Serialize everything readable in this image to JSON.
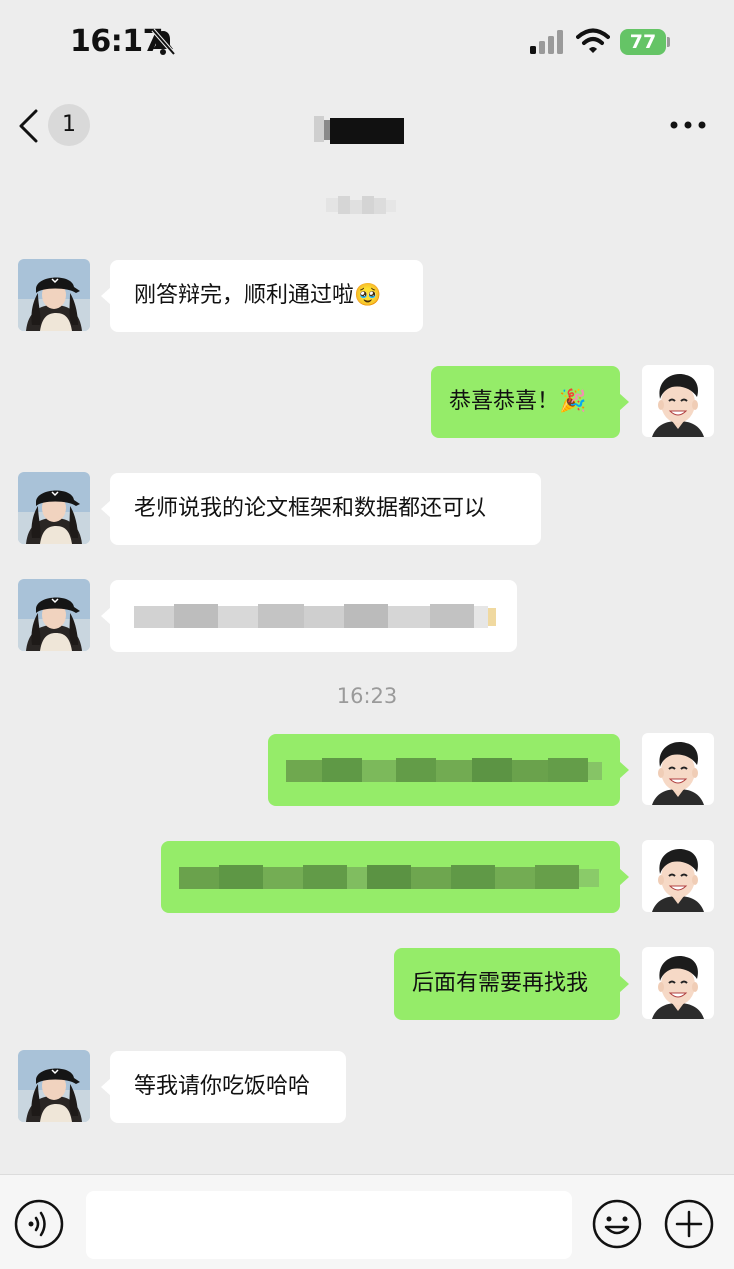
{
  "status_bar": {
    "time": "16:17",
    "battery": "77"
  },
  "nav": {
    "unread_count": "1",
    "more_icon": "more-dots-icon",
    "back_icon": "back-chevron-icon"
  },
  "timestamps": {
    "second": "16:23"
  },
  "messages": [
    {
      "side": "left",
      "text": "刚答辩完，顺利通过啦🥹"
    },
    {
      "side": "right",
      "text": "恭喜恭喜！🎉"
    },
    {
      "side": "left",
      "text": "老师说我的论文框架和数据都还可以"
    },
    {
      "side": "left",
      "text": ""
    },
    {
      "side": "right",
      "text": ""
    },
    {
      "side": "right",
      "text": ""
    },
    {
      "side": "right",
      "text": "后面有需要再找我"
    },
    {
      "side": "left",
      "text": "等我请你吃饭哈哈"
    }
  ],
  "input_bar": {
    "placeholder": ""
  },
  "colors": {
    "background": "#ededed",
    "sent_bubble": "#95ec69",
    "received_bubble": "#ffffff",
    "battery": "#65c466"
  }
}
